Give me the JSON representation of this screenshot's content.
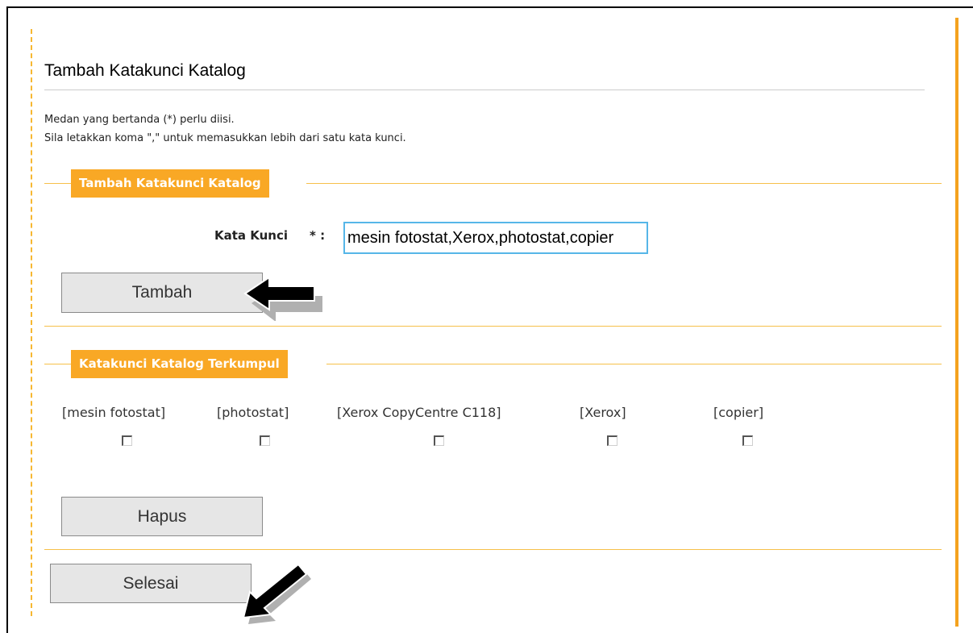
{
  "page": {
    "title": "Tambah Katakunci Katalog",
    "notes": [
      "Medan yang bertanda (*) perlu diisi.",
      "Sila letakkan koma \",\" untuk memasukkan lebih dari satu kata kunci."
    ]
  },
  "add_section": {
    "legend": "Tambah Katakunci Katalog",
    "field_label": "Kata Kunci",
    "required_marker": "* :",
    "input_value": "mesin fotostat,Xerox,photostat,copier",
    "add_button": "Tambah"
  },
  "collected_section": {
    "legend": "Katakunci Katalog Terkumpul",
    "keywords": [
      {
        "label": "[mesin fotostat]",
        "checked": false
      },
      {
        "label": "[photostat]",
        "checked": false
      },
      {
        "label": "[Xerox CopyCentre C118]",
        "checked": false
      },
      {
        "label": "[Xerox]",
        "checked": false
      },
      {
        "label": "[copier]",
        "checked": false
      }
    ],
    "delete_button": "Hapus"
  },
  "footer": {
    "finish_button": "Selesai"
  },
  "annotations": {
    "arrow_icon": "black-pointer-arrow-icon"
  },
  "colors": {
    "accent": "#f9a825",
    "rule": "#f6c04a",
    "input_border": "#56b6e8"
  }
}
